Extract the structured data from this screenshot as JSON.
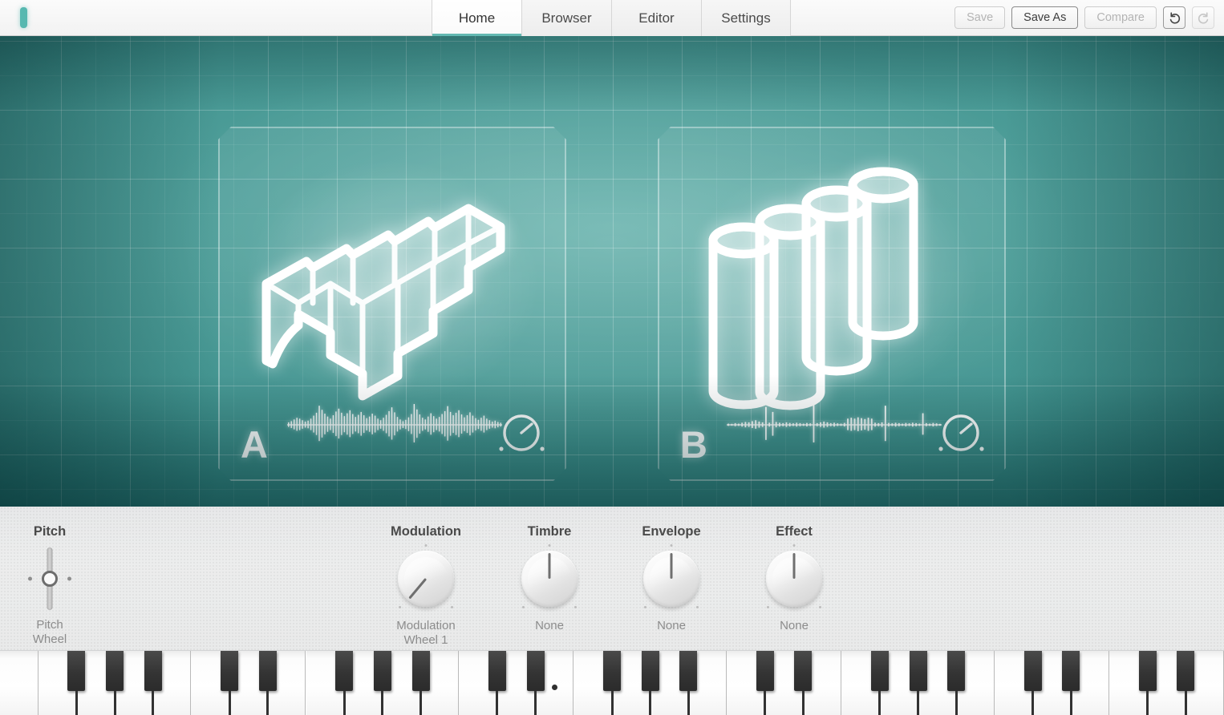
{
  "app": {
    "brand_mark": "teal-logo-bar",
    "background_accent": "#3f918d",
    "accent": "#63b9b2"
  },
  "topbar": {
    "tabs": [
      {
        "label": "Home",
        "active": true
      },
      {
        "label": "Browser",
        "active": false
      },
      {
        "label": "Editor",
        "active": false
      },
      {
        "label": "Settings",
        "active": false
      }
    ],
    "actions": {
      "save": {
        "label": "Save",
        "enabled": false
      },
      "save_as": {
        "label": "Save As",
        "enabled": true
      },
      "compare": {
        "label": "Compare",
        "enabled": false
      },
      "undo": {
        "icon": "undo-icon",
        "enabled": true
      },
      "redo": {
        "icon": "redo-icon",
        "enabled": false
      }
    }
  },
  "stage": {
    "layers": [
      {
        "id": "A",
        "letter": "A",
        "icon": "bar-blocks-icon",
        "knob": {
          "icon": "layer-knob-icon",
          "angle_deg": 52
        },
        "waveform": [
          0.12,
          0.18,
          0.26,
          0.34,
          0.3,
          0.22,
          0.16,
          0.2,
          0.3,
          0.44,
          0.58,
          0.92,
          0.72,
          0.54,
          0.4,
          0.3,
          0.46,
          0.64,
          0.78,
          0.58,
          0.42,
          0.56,
          0.7,
          0.52,
          0.38,
          0.48,
          0.62,
          0.46,
          0.32,
          0.4,
          0.54,
          0.44,
          0.3,
          0.22,
          0.34,
          0.48,
          0.66,
          0.84,
          0.6,
          0.38,
          0.26,
          0.18,
          0.24,
          0.36,
          0.52,
          1.0,
          0.74,
          0.5,
          0.34,
          0.26,
          0.4,
          0.56,
          0.42,
          0.3,
          0.38,
          0.52,
          0.66,
          0.9,
          0.62,
          0.46,
          0.58,
          0.7,
          0.5,
          0.36,
          0.46,
          0.6,
          0.44,
          0.32,
          0.24,
          0.34,
          0.44,
          0.3,
          0.22,
          0.16,
          0.2,
          0.14,
          0.1
        ]
      },
      {
        "id": "B",
        "letter": "B",
        "icon": "cylinders-icon",
        "knob": {
          "icon": "layer-knob-icon",
          "angle_deg": 52
        },
        "waveform": [
          0.06,
          0.05,
          0.08,
          0.06,
          0.1,
          0.14,
          0.12,
          0.18,
          0.22,
          0.16,
          0.12,
          0.86,
          0.1,
          0.62,
          0.14,
          0.1,
          0.08,
          0.12,
          0.09,
          0.07,
          0.1,
          0.08,
          0.06,
          0.09,
          0.07,
          1.0,
          0.08,
          0.12,
          0.16,
          0.12,
          0.08,
          0.1,
          0.07,
          0.06,
          0.09,
          0.3,
          0.34,
          0.3,
          0.36,
          0.32,
          0.28,
          0.34,
          0.3,
          0.1,
          0.08,
          0.12,
          0.92,
          0.09,
          0.07,
          0.1,
          0.08,
          0.06,
          0.09,
          0.07,
          0.1,
          0.08,
          0.06,
          0.56,
          0.08,
          0.06,
          0.09,
          0.07,
          0.05
        ]
      }
    ]
  },
  "controls": [
    {
      "name": "pitch",
      "caption": "Pitch",
      "value": "Pitch\nWheel",
      "type": "wheel",
      "position": 0.5
    },
    {
      "name": "modulation",
      "caption": "Modulation",
      "value": "Modulation\nWheel 1",
      "type": "knob",
      "angle_deg": -140
    },
    {
      "name": "timbre",
      "caption": "Timbre",
      "value": "None",
      "type": "knob",
      "angle_deg": 0
    },
    {
      "name": "envelope",
      "caption": "Envelope",
      "value": "None",
      "type": "knob",
      "angle_deg": 0
    },
    {
      "name": "effect",
      "caption": "Effect",
      "value": "None",
      "type": "knob",
      "angle_deg": 0
    }
  ],
  "keyboard": {
    "white_key_count": 32,
    "marked_key_index": 14,
    "marker": "middle-c-dot"
  }
}
